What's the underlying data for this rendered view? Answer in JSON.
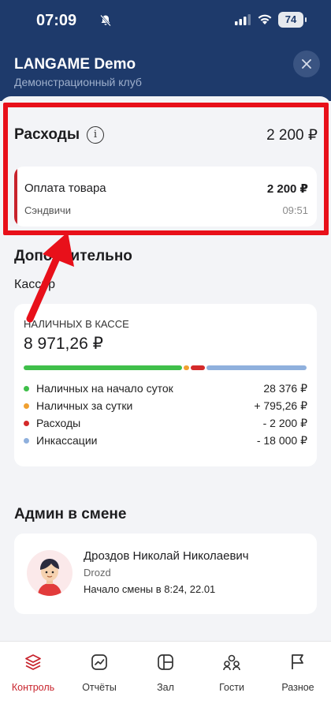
{
  "status": {
    "time": "07:09",
    "battery": "74"
  },
  "header": {
    "title": "LANGAME Demo",
    "subtitle": "Демонстрационный клуб"
  },
  "expenses": {
    "title": "Расходы",
    "total": "2 200 ₽",
    "item": {
      "name": "Оплата товара",
      "amount": "2 200 ₽",
      "category": "Сэндвичи",
      "time": "09:51"
    }
  },
  "additional": {
    "title": "Дополнительно",
    "cashier_label": "Кассир",
    "cash_caption": "НАЛИЧНЫХ В КАССЕ",
    "cash_value": "8 971,26 ₽",
    "bar_segments": [
      {
        "fraction": 0.57,
        "color": "#3fbf4a"
      },
      {
        "fraction": 0.02,
        "color": "#f0a030"
      },
      {
        "fraction": 0.05,
        "color": "#d42a2a"
      },
      {
        "fraction": 0.36,
        "color": "#8fb0dd"
      }
    ],
    "legend": [
      {
        "label": "Наличных на начало суток",
        "value": "28 376 ₽",
        "color": "#3fbf4a"
      },
      {
        "label": "Наличных за сутки",
        "value": "+ 795,26 ₽",
        "color": "#f0a030"
      },
      {
        "label": "Расходы",
        "value": "- 2 200 ₽",
        "color": "#d42a2a"
      },
      {
        "label": "Инкассации",
        "value": "- 18 000 ₽",
        "color": "#8fb0dd"
      }
    ]
  },
  "admin": {
    "title": "Админ в смене",
    "name": "Дроздов Николай Николаевич",
    "login": "Drozd",
    "shift": "Начало смены в 8:24, 22.01"
  },
  "nav": [
    {
      "label": "Контроль",
      "icon": "layers-icon",
      "active": true
    },
    {
      "label": "Отчёты",
      "icon": "chart-icon",
      "active": false
    },
    {
      "label": "Зал",
      "icon": "hall-icon",
      "active": false
    },
    {
      "label": "Гости",
      "icon": "users-icon",
      "active": false
    },
    {
      "label": "Разное",
      "icon": "flag-icon",
      "active": false
    }
  ],
  "colors": {
    "header_bg": "#1e3a6b",
    "accent": "#c8232c",
    "highlight": "#e8101a"
  }
}
